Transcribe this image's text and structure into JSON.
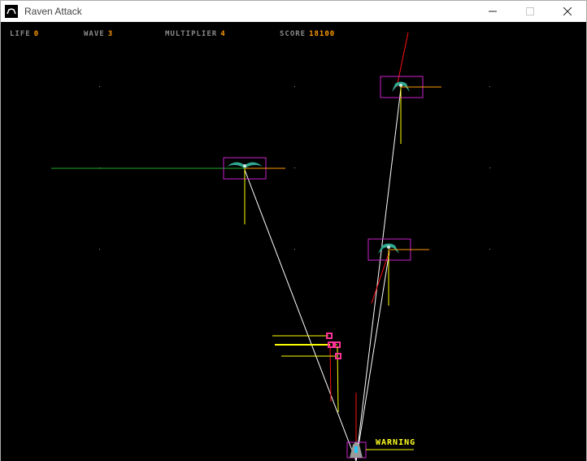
{
  "window": {
    "title": "Raven Attack",
    "icon": "raven-app-icon"
  },
  "hud": {
    "life_label": "LIFE",
    "life_value": "0",
    "wave_label": "WAVE",
    "wave_value": "3",
    "multiplier_label": "MULTIPLIER",
    "multiplier_value": "4",
    "score_label": "SCORE",
    "score_value": "18100"
  },
  "warning_text": "WARNING",
  "colors": {
    "background": "#000000",
    "hud_label": "#8a8a8a",
    "hud_value": "#ff9a00",
    "warning": "#ffff22",
    "bounding_box": "#cc22cc",
    "raven_body": "#2fa88f",
    "target_line": "#ffffff",
    "laser_red": "#ff1010",
    "yellow_line": "#ffff00",
    "orange_line": "#ff9900",
    "green_line": "#22aa22",
    "pink_marker": "#ff3399"
  },
  "entities": {
    "ravens": 3,
    "player_ship": 1,
    "projectiles": 4
  }
}
